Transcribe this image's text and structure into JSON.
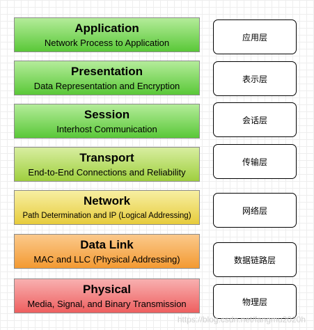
{
  "layers": [
    {
      "name": "Application",
      "desc": "Network Process to Application",
      "cn": "应用层",
      "color_top": "#b4ec9a",
      "color_bottom": "#5ac838"
    },
    {
      "name": "Presentation",
      "desc": "Data Representation and Encryption",
      "cn": "表示层",
      "color_top": "#b4ec9a",
      "color_bottom": "#5ac838"
    },
    {
      "name": "Session",
      "desc": "Interhost Communication",
      "cn": "会话层",
      "color_top": "#b4ec9a",
      "color_bottom": "#5ac838"
    },
    {
      "name": "Transport",
      "desc": "End-to-End Connections and Reliability",
      "cn": "传输层",
      "color_top": "#d8eea0",
      "color_bottom": "#9fcf3f"
    },
    {
      "name": "Network",
      "desc": "Path Determination and IP (Logical Addressing)",
      "cn": "网络层",
      "color_top": "#f7efa2",
      "color_bottom": "#e7cc3c"
    },
    {
      "name": "Data Link",
      "desc": "MAC and LLC (Physical Addressing)",
      "cn": "数据链路层",
      "color_top": "#fbc98c",
      "color_bottom": "#f39a32"
    },
    {
      "name": "Physical",
      "desc": "Media, Signal, and Binary Transmission",
      "cn": "物理层",
      "color_top": "#f8b0b0",
      "color_bottom": "#ee5f5f"
    }
  ],
  "watermark": "https://blog.csdn.net/fangmu2020h"
}
